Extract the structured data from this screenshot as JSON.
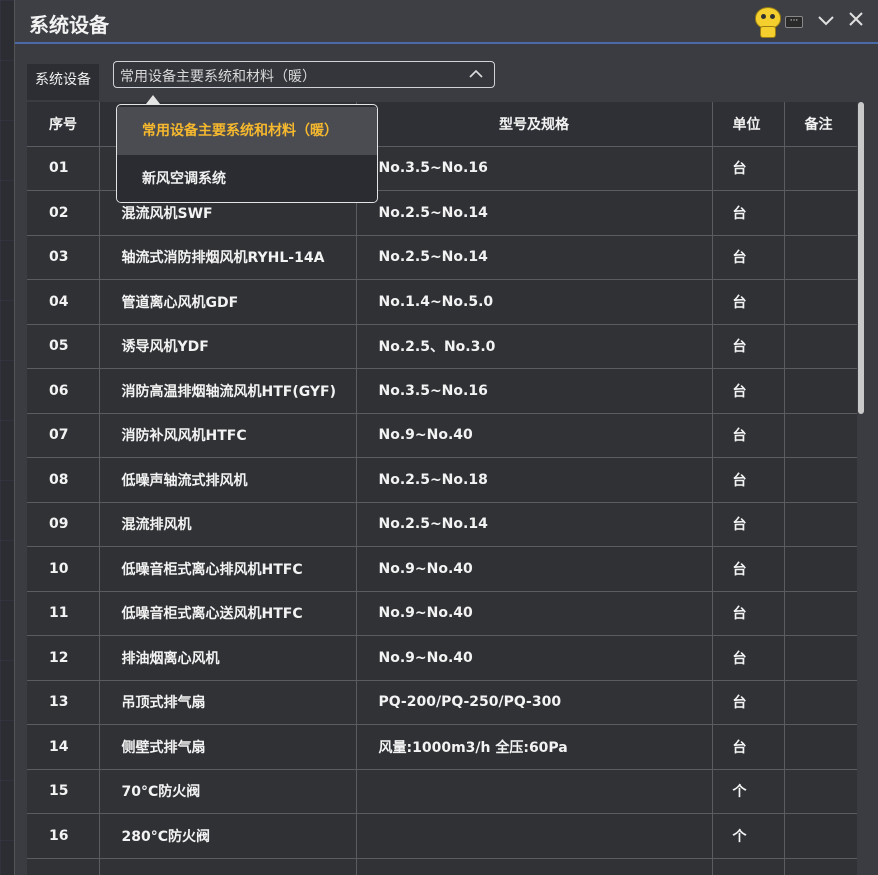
{
  "window": {
    "title": "系统设备",
    "more_badge": "···"
  },
  "filter": {
    "label": "系统设备",
    "selected": "常用设备主要系统和材料（暖）",
    "options": [
      "常用设备主要系统和材料（暖）",
      "新风空调系统"
    ]
  },
  "table": {
    "headers": {
      "index": "序号",
      "name": "",
      "spec": "型号及规格",
      "unit": "单位",
      "note": "备注"
    },
    "rows": [
      {
        "index": "01",
        "name": "",
        "spec": "No.3.5~No.16",
        "unit": "台",
        "note": ""
      },
      {
        "index": "02",
        "name": "混流风机SWF",
        "spec": "No.2.5~No.14",
        "unit": "台",
        "note": ""
      },
      {
        "index": "03",
        "name": "轴流式消防排烟风机RYHL-14A",
        "spec": "No.2.5~No.14",
        "unit": "台",
        "note": ""
      },
      {
        "index": "04",
        "name": "管道离心风机GDF",
        "spec": "No.1.4~No.5.0",
        "unit": "台",
        "note": ""
      },
      {
        "index": "05",
        "name": "诱导风机YDF",
        "spec": "No.2.5、No.3.0",
        "unit": "台",
        "note": ""
      },
      {
        "index": "06",
        "name": "消防高温排烟轴流风机HTF(GYF)",
        "spec": "No.3.5~No.16",
        "unit": "台",
        "note": ""
      },
      {
        "index": "07",
        "name": "消防补风风机HTFC",
        "spec": "No.9~No.40",
        "unit": "台",
        "note": ""
      },
      {
        "index": "08",
        "name": "低噪声轴流式排风机",
        "spec": "No.2.5~No.18",
        "unit": "台",
        "note": ""
      },
      {
        "index": "09",
        "name": "混流排风机",
        "spec": "No.2.5~No.14",
        "unit": "台",
        "note": ""
      },
      {
        "index": "10",
        "name": "低噪音柜式离心排风机HTFC",
        "spec": "No.9~No.40",
        "unit": "台",
        "note": ""
      },
      {
        "index": "11",
        "name": "低噪音柜式离心送风机HTFC",
        "spec": "No.9~No.40",
        "unit": "台",
        "note": ""
      },
      {
        "index": "12",
        "name": "排油烟离心风机",
        "spec": "No.9~No.40",
        "unit": "台",
        "note": ""
      },
      {
        "index": "13",
        "name": "吊顶式排气扇",
        "spec": "PQ-200/PQ-250/PQ-300",
        "unit": "台",
        "note": ""
      },
      {
        "index": "14",
        "name": "侧壁式排气扇",
        "spec": "风量:1000m3/h 全压:60Pa",
        "unit": "台",
        "note": ""
      },
      {
        "index": "15",
        "name": "70°C防火阀",
        "spec": "",
        "unit": "个",
        "note": ""
      },
      {
        "index": "16",
        "name": "280°C防火阀",
        "spec": "",
        "unit": "个",
        "note": ""
      },
      {
        "index": "",
        "name": "",
        "spec": "",
        "unit": "",
        "note": ""
      }
    ]
  },
  "colors": {
    "accent": "#f5b82e",
    "title_border": "#4a6aa8"
  }
}
